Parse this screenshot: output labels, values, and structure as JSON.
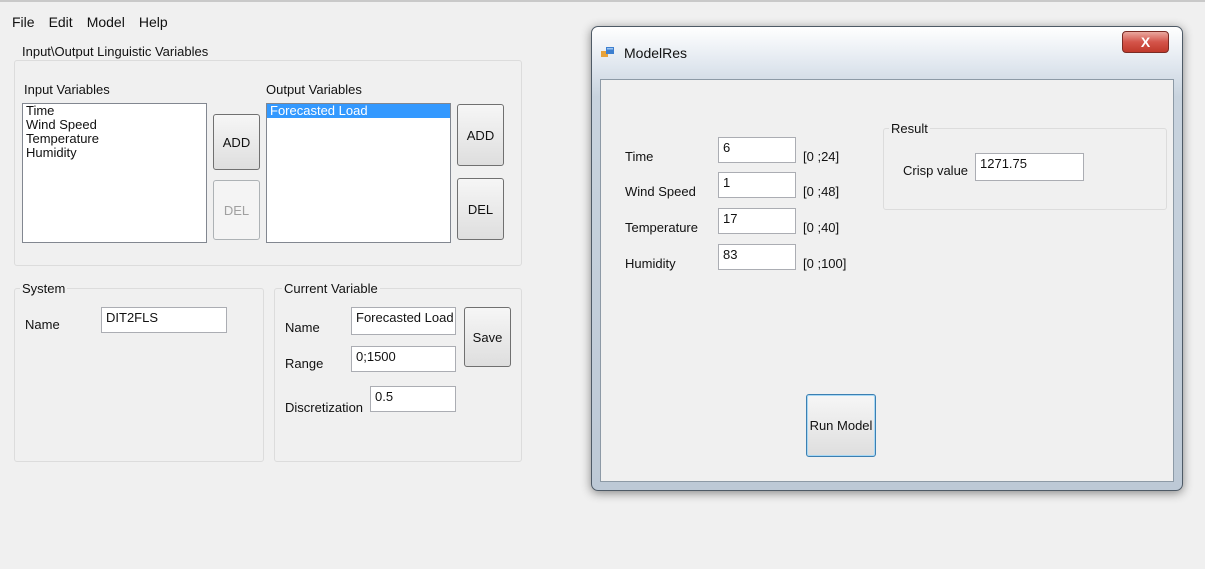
{
  "menu": [
    "File",
    "Edit",
    "Model",
    "Help"
  ],
  "io_group": {
    "title": "Input\\Output Linguistic Variables",
    "input_label": "Input Variables",
    "input_items": [
      "Time",
      "Wind Speed",
      "Temperature",
      "Humidity"
    ],
    "output_label": "Output Variables",
    "output_items": [
      "Forecasted Load"
    ],
    "add_label": "ADD",
    "del_label": "DEL"
  },
  "system": {
    "title": "System",
    "name_label": "Name",
    "name_value": "DIT2FLS"
  },
  "current_variable": {
    "title": "Current Variable",
    "name_label": "Name",
    "name_value": "Forecasted Load",
    "range_label": "Range",
    "range_value": "0;1500",
    "discretization_label": "Discretization",
    "discretization_value": "0.5",
    "save_label": "Save"
  },
  "dialog": {
    "title": "ModelRes",
    "close_glyph": "X",
    "inputs": [
      {
        "label": "Time",
        "value": "6",
        "range": "[0 ;24]"
      },
      {
        "label": "Wind Speed",
        "value": "1",
        "range": "[0 ;48]"
      },
      {
        "label": "Temperature",
        "value": "17",
        "range": "[0 ;40]"
      },
      {
        "label": "Humidity",
        "value": "83",
        "range": "[0 ;100]"
      }
    ],
    "result": {
      "title": "Result",
      "crisp_label": "Crisp value",
      "crisp_value": "1271.75"
    },
    "run_label": "Run Model"
  }
}
